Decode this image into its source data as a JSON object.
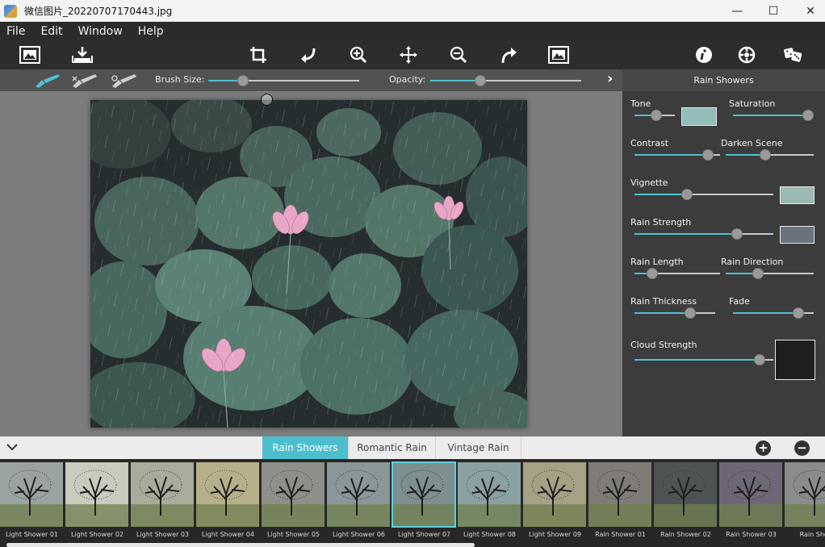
{
  "window": {
    "title": "微信图片_20220707170443.jpg",
    "minimize": "—",
    "maximize": "☐",
    "close": "✕"
  },
  "menu": [
    "File",
    "Edit",
    "Window",
    "Help"
  ],
  "toolbar": {
    "icons": [
      "open-image-icon",
      "save-icon",
      "crop-icon",
      "rotate-left-icon",
      "zoom-in-icon",
      "move-icon",
      "zoom-out-icon",
      "rotate-right-icon",
      "fit-image-icon",
      "info-icon",
      "settings-icon",
      "random-icon"
    ]
  },
  "brushbar": {
    "brush_size_label": "Brush Size:",
    "brush_size_value": 0.23,
    "opacity_label": "Opacity:",
    "opacity_value": 0.33,
    "expand_glyph": "›"
  },
  "panel": {
    "title": "Rain Showers",
    "controls": {
      "tone": {
        "label": "Tone",
        "value": 0.53
      },
      "saturation": {
        "label": "Saturation",
        "value": 0.93
      },
      "contrast": {
        "label": "Contrast",
        "value": 0.86
      },
      "darken_scene": {
        "label": "Darken Scene",
        "value": 0.45
      },
      "vignette": {
        "label": "Vignette",
        "value": 0.38
      },
      "rain_strength": {
        "label": "Rain Strength",
        "value": 0.74
      },
      "rain_length": {
        "label": "Rain Length",
        "value": 0.21
      },
      "rain_direction": {
        "label": "Rain Direction",
        "value": 0.37
      },
      "rain_thickness": {
        "label": "Rain Thickness",
        "value": 0.69
      },
      "fade": {
        "label": "Fade",
        "value": 0.81
      },
      "cloud_strength": {
        "label": "Cloud Strength",
        "value": 0.9
      }
    },
    "swatches": {
      "tone": "#93bdb8",
      "vignette": "#9ab9b3",
      "rain_strength": "#6a737c",
      "cloud": "#1e1e1f"
    }
  },
  "presets": {
    "tabs": [
      "Rain Showers",
      "Romantic Rain",
      "Vintage Rain"
    ],
    "active_tab": "Rain Showers",
    "add_glyph": "+",
    "remove_glyph": "−",
    "thumbnails": [
      "Light Shower 01",
      "Light Shower 02",
      "Light Shower 03",
      "Light Shower 04",
      "Light Shower 05",
      "Light Shower 06",
      "Light Shower 07",
      "Light Shower 08",
      "Light Shower 09",
      "Rain Shower 01",
      "Rain Shower 02",
      "Rain Shower 03",
      "Rain Show"
    ],
    "selected_index": 6,
    "thumb_tints": [
      "#9aa3a1",
      "#c8cbbd",
      "#a9ab9b",
      "#b6b08a",
      "#8d8f88",
      "#8b9699",
      "#7d8f8e",
      "#8aa0a2",
      "#a6a084",
      "#7f7b76",
      "#4e5454",
      "#6e6876",
      "#8a8c8a"
    ]
  },
  "colors": {
    "accent": "#4cbfcf"
  }
}
